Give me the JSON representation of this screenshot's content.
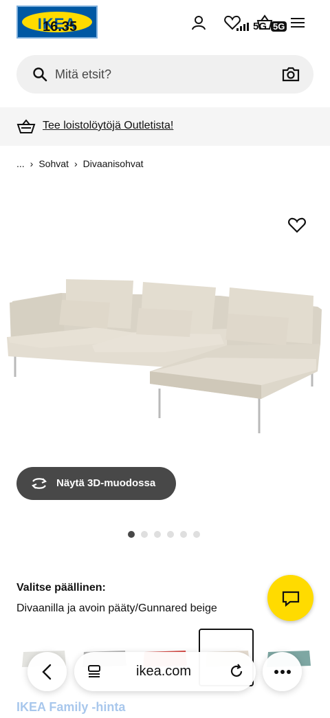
{
  "status_bar": {
    "time": "16.35",
    "network": "5G",
    "network_badge": "5G"
  },
  "header": {
    "logo_text": "IKEA"
  },
  "search": {
    "placeholder": "Mitä etsit?"
  },
  "promo": {
    "link_text": "Tee loistolöytöjä Outletista!"
  },
  "breadcrumb": {
    "ellipsis": "...",
    "items": [
      "Sohvat",
      "Divaanisohvat"
    ]
  },
  "product": {
    "view_3d_label": "Näytä 3D-muodossa",
    "image_count": 6,
    "active_image_index": 0
  },
  "cover": {
    "title": "Valitse päällinen:",
    "value": "Divaanilla ja avoin pääty/Gunnared beige"
  },
  "swatches": {
    "colors": [
      "#e4e4e0",
      "#b5b5b5",
      "#d94a45",
      "#e6ddd1",
      "#7ea7a3"
    ],
    "selected_index": 3
  },
  "price": {
    "family_label": "IKEA Family -hinta"
  },
  "browser": {
    "url": "ikea.com"
  },
  "colors": {
    "brand_blue": "#0058a3",
    "brand_yellow": "#ffdb00",
    "dark_button": "#484848"
  }
}
